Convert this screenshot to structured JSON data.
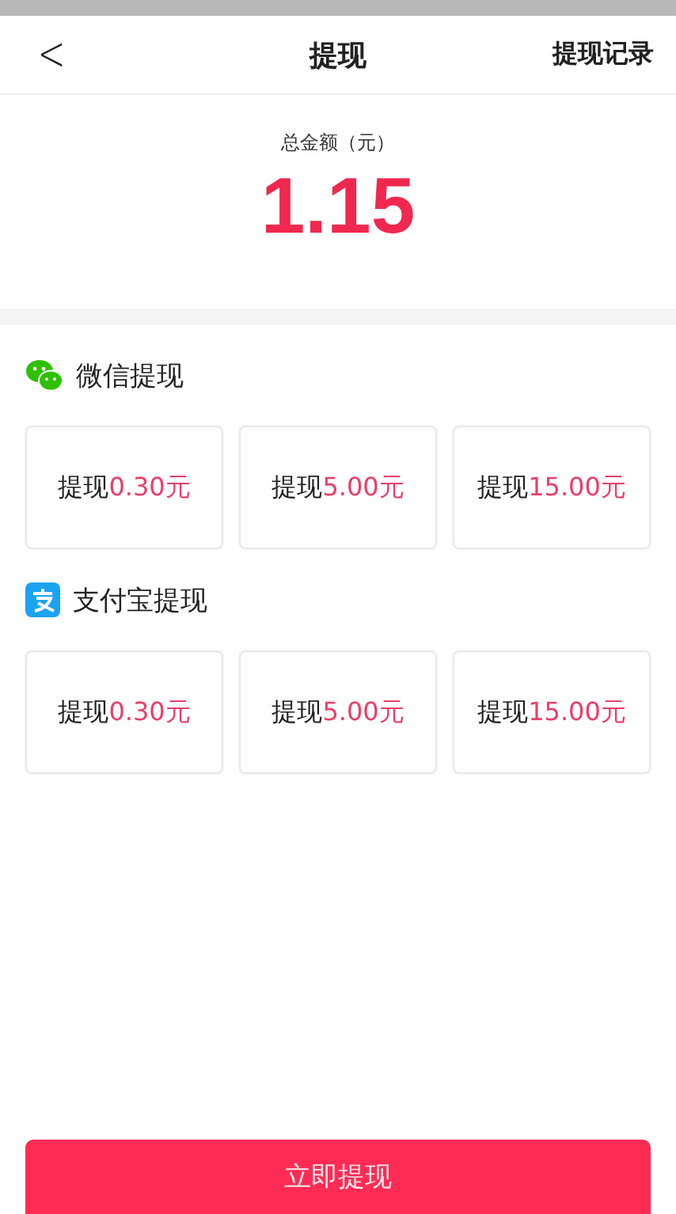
{
  "header": {
    "back": "<",
    "title": "提现",
    "action": "提现记录"
  },
  "balance": {
    "label": "总金额（元）",
    "amount": "1.15"
  },
  "sections": [
    {
      "kind": "wechat",
      "title": "微信提现",
      "options": [
        {
          "label": "提现",
          "amount": "0.30元"
        },
        {
          "label": "提现",
          "amount": "5.00元"
        },
        {
          "label": "提现",
          "amount": "15.00元"
        }
      ]
    },
    {
      "kind": "alipay",
      "title": "支付宝提现",
      "options": [
        {
          "label": "提现",
          "amount": "0.30元"
        },
        {
          "label": "提现",
          "amount": "5.00元"
        },
        {
          "label": "提现",
          "amount": "15.00元"
        }
      ]
    }
  ],
  "submit": "立即提现"
}
